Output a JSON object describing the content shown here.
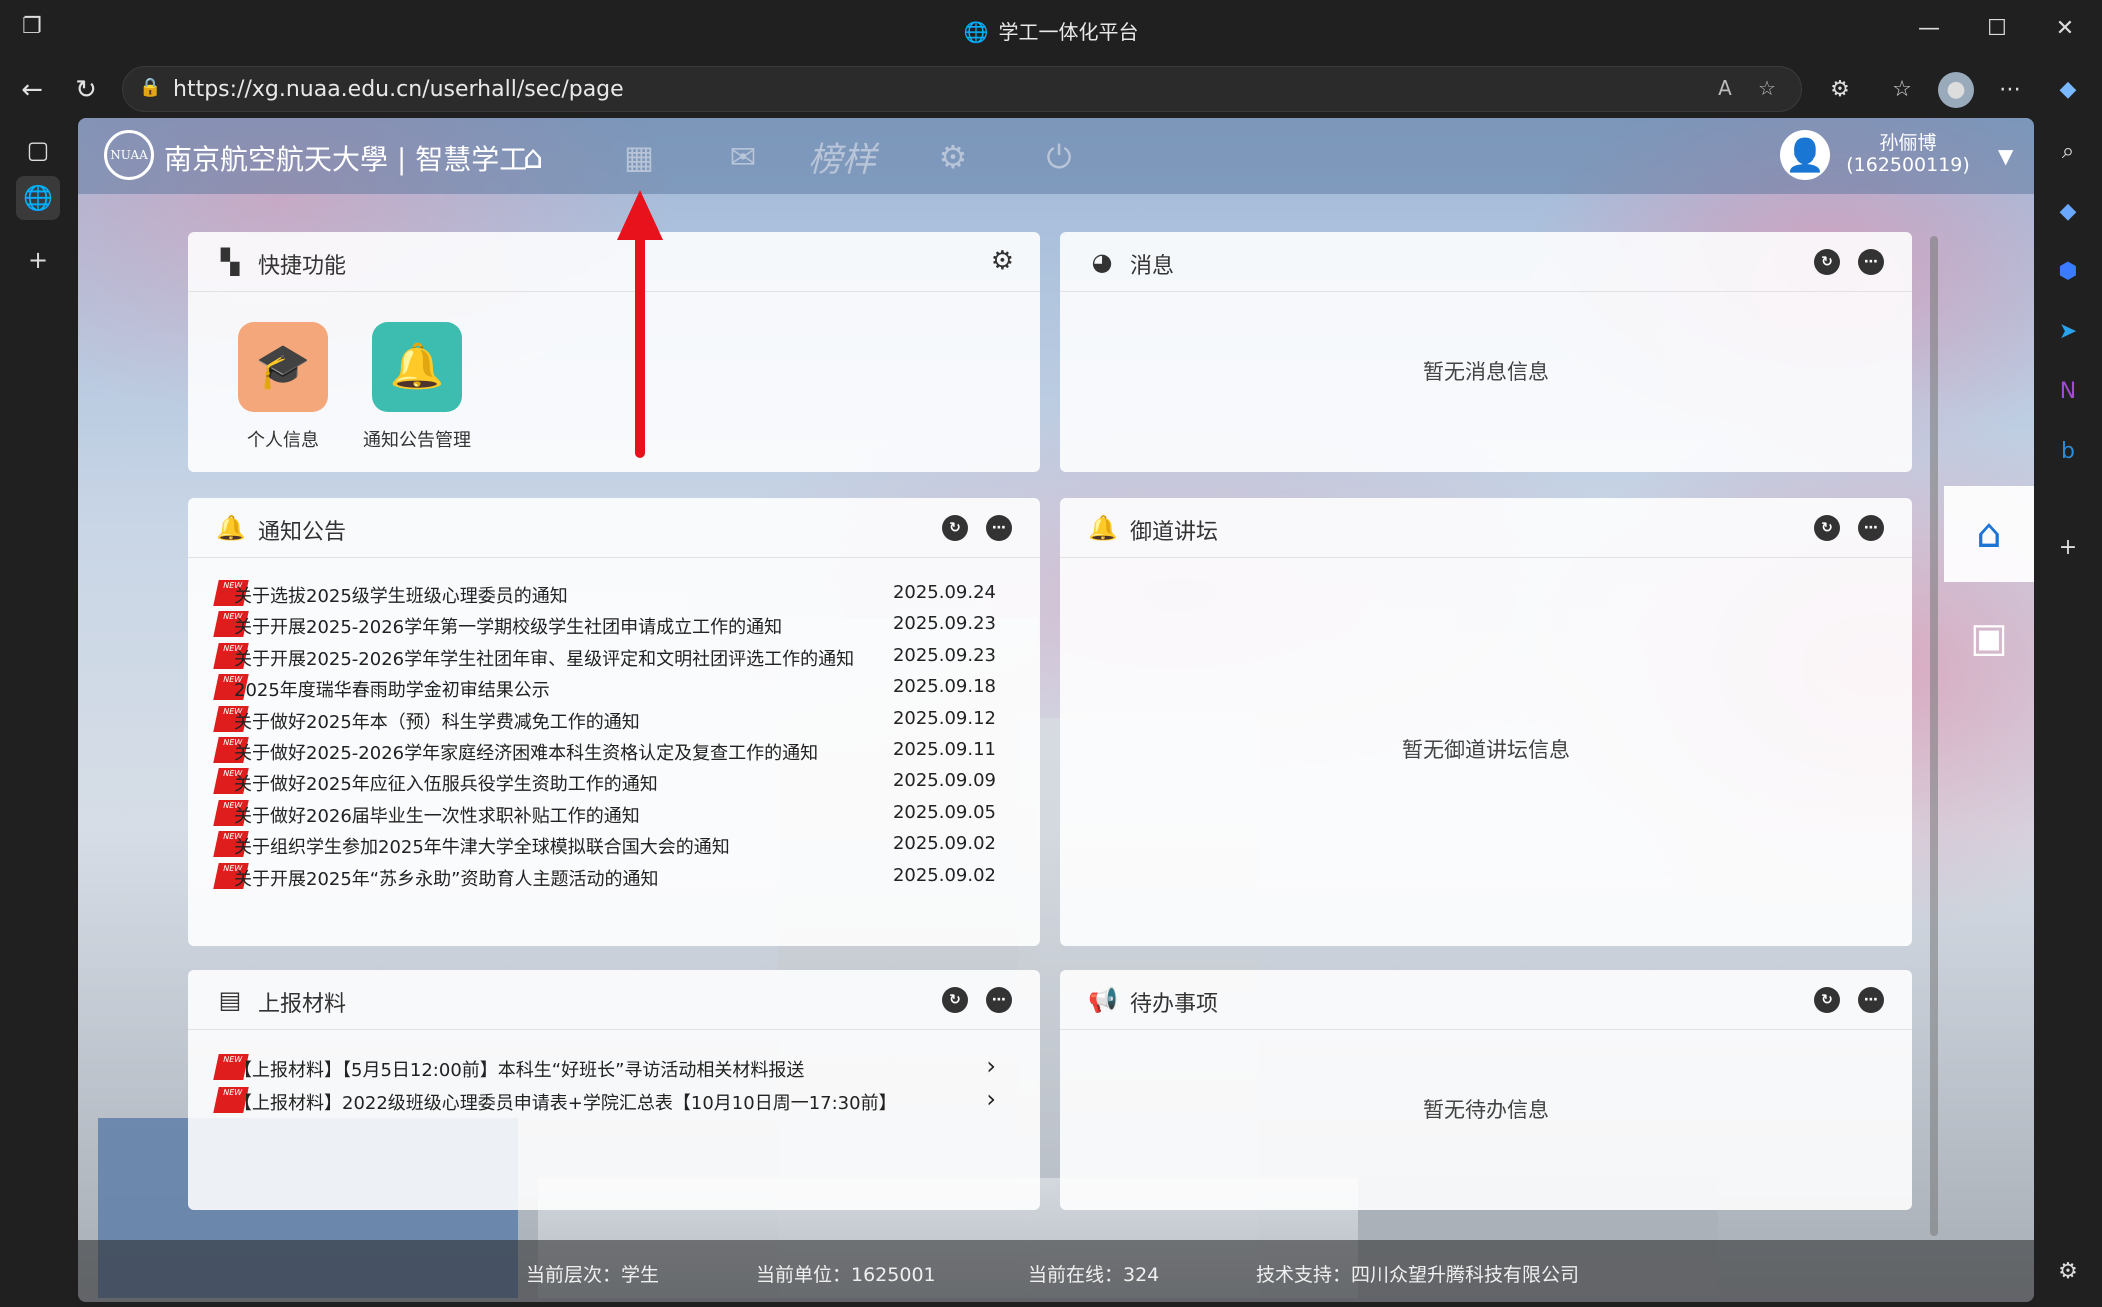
{
  "browser": {
    "window_title": "学工一体化平台",
    "url": "https://xg.nuaa.edu.cn/userhall/sec/page"
  },
  "site": {
    "logo_text": "南京航空航天大學 | 智慧学工",
    "seal_text": "NUAA",
    "nav_badge_text": "榜样",
    "user_name": "孙俪博",
    "user_id": "(162500119)"
  },
  "quick": {
    "title": "快捷功能",
    "items": [
      {
        "label": "个人信息"
      },
      {
        "label": "通知公告管理"
      }
    ]
  },
  "messages": {
    "title": "消息",
    "empty": "暂无消息信息"
  },
  "notices": {
    "title": "通知公告",
    "new_tag": "NEW",
    "items": [
      {
        "title": "关于选拔2025级学生班级心理委员的通知",
        "date": "2025.09.24"
      },
      {
        "title": "关于开展2025-2026学年第一学期校级学生社团申请成立工作的通知",
        "date": "2025.09.23"
      },
      {
        "title": "关于开展2025-2026学年学生社团年审、星级评定和文明社团评选工作的通知",
        "date": "2025.09.23"
      },
      {
        "title": "2025年度瑞华春雨助学金初审结果公示",
        "date": "2025.09.18"
      },
      {
        "title": "关于做好2025年本（预）科生学费减免工作的通知",
        "date": "2025.09.12"
      },
      {
        "title": "关于做好2025-2026学年家庭经济困难本科生资格认定及复查工作的通知",
        "date": "2025.09.11"
      },
      {
        "title": "关于做好2025年应征入伍服兵役学生资助工作的通知",
        "date": "2025.09.09"
      },
      {
        "title": "关于做好2026届毕业生一次性求职补贴工作的通知",
        "date": "2025.09.05"
      },
      {
        "title": "关于组织学生参加2025年牛津大学全球模拟联合国大会的通知",
        "date": "2025.09.02"
      },
      {
        "title": "关于开展2025年“苏乡永助”资助育人主题活动的通知",
        "date": "2025.09.02"
      }
    ]
  },
  "forum": {
    "title": "御道讲坛",
    "empty": "暂无御道讲坛信息"
  },
  "reports": {
    "title": "上报材料",
    "items": [
      {
        "title": "【上报材料】【5月5日12:00前】本科生“好班长”寻访活动相关材料报送"
      },
      {
        "title": "【上报材料】2022级班级心理委员申请表+学院汇总表【10月10日周一17:30前】"
      }
    ]
  },
  "todo": {
    "title": "待办事项",
    "empty": "暂无待办信息"
  },
  "footer": {
    "level": "当前层次：学生",
    "unit": "当前单位：1625001",
    "online": "当前在线：324",
    "support": "技术支持：四川众望升腾科技有限公司"
  },
  "colors": {
    "accent_red": "#e8121c",
    "quick_person_bg": "#f4a77a",
    "quick_bell_bg": "#3cbdb0",
    "link_blue": "#1e90ff"
  }
}
